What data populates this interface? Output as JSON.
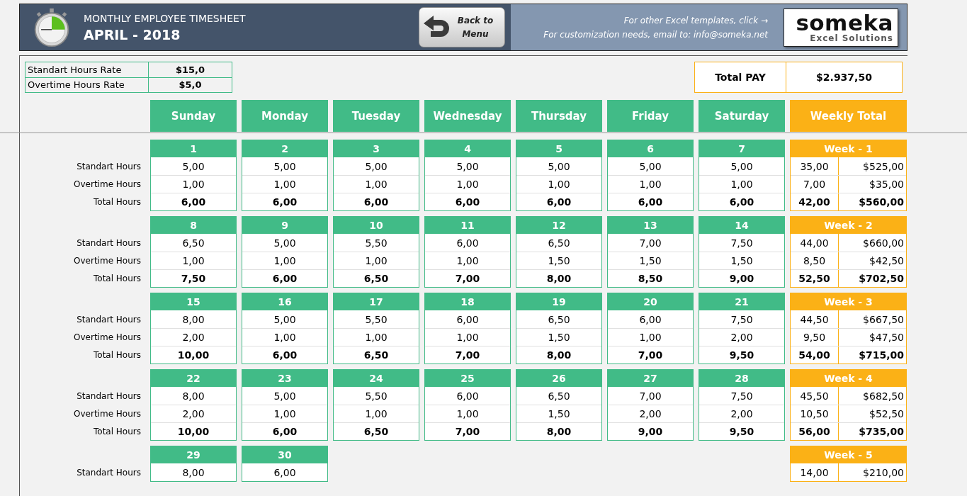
{
  "header": {
    "subtitle": "MONTHLY EMPLOYEE TIMESHEET",
    "title": "APRIL - 2018",
    "back_button": "Back to Menu",
    "info_lines": [
      "For other Excel templates, click →",
      "For customization needs, email to: info@someka.net"
    ],
    "logo": {
      "name": "someka",
      "tagline": "Excel Solutions"
    }
  },
  "rates": [
    {
      "label": "Standart Hours Rate",
      "value": "$15,0"
    },
    {
      "label": "Overtime Hours Rate",
      "value": "$5,0"
    }
  ],
  "total_pay": {
    "label": "Total PAY",
    "value": "$2.937,50"
  },
  "day_names": [
    "Sunday",
    "Monday",
    "Tuesday",
    "Wednesday",
    "Thursday",
    "Friday",
    "Saturday"
  ],
  "weekly_total_label": "Weekly Total",
  "weeks": [
    {
      "label": "Week - 1",
      "dates": [
        "1",
        "2",
        "3",
        "4",
        "5",
        "6",
        "7"
      ],
      "rows": [
        {
          "kind": "standard",
          "label": "Standart Hours",
          "values": [
            "5,00",
            "5,00",
            "5,00",
            "5,00",
            "5,00",
            "5,00",
            "5,00"
          ],
          "hours": "35,00",
          "pay": "$525,00"
        },
        {
          "kind": "overtime",
          "label": "Overtime Hours",
          "values": [
            "1,00",
            "1,00",
            "1,00",
            "1,00",
            "1,00",
            "1,00",
            "1,00"
          ],
          "hours": "7,00",
          "pay": "$35,00"
        },
        {
          "kind": "total",
          "label": "Total Hours",
          "values": [
            "6,00",
            "6,00",
            "6,00",
            "6,00",
            "6,00",
            "6,00",
            "6,00"
          ],
          "hours": "42,00",
          "pay": "$560,00"
        }
      ]
    },
    {
      "label": "Week - 2",
      "dates": [
        "8",
        "9",
        "10",
        "11",
        "12",
        "13",
        "14"
      ],
      "rows": [
        {
          "kind": "standard",
          "label": "Standart Hours",
          "values": [
            "6,50",
            "5,00",
            "5,50",
            "6,00",
            "6,50",
            "7,00",
            "7,50"
          ],
          "hours": "44,00",
          "pay": "$660,00"
        },
        {
          "kind": "overtime",
          "label": "Overtime Hours",
          "values": [
            "1,00",
            "1,00",
            "1,00",
            "1,00",
            "1,50",
            "1,50",
            "1,50"
          ],
          "hours": "8,50",
          "pay": "$42,50"
        },
        {
          "kind": "total",
          "label": "Total Hours",
          "values": [
            "7,50",
            "6,00",
            "6,50",
            "7,00",
            "8,00",
            "8,50",
            "9,00"
          ],
          "hours": "52,50",
          "pay": "$702,50"
        }
      ]
    },
    {
      "label": "Week - 3",
      "dates": [
        "15",
        "16",
        "17",
        "18",
        "19",
        "20",
        "21"
      ],
      "rows": [
        {
          "kind": "standard",
          "label": "Standart Hours",
          "values": [
            "8,00",
            "5,00",
            "5,50",
            "6,00",
            "6,50",
            "6,00",
            "7,50"
          ],
          "hours": "44,50",
          "pay": "$667,50"
        },
        {
          "kind": "overtime",
          "label": "Overtime Hours",
          "values": [
            "2,00",
            "1,00",
            "1,00",
            "1,00",
            "1,50",
            "1,00",
            "2,00"
          ],
          "hours": "9,50",
          "pay": "$47,50"
        },
        {
          "kind": "total",
          "label": "Total Hours",
          "values": [
            "10,00",
            "6,00",
            "6,50",
            "7,00",
            "8,00",
            "7,00",
            "9,50"
          ],
          "hours": "54,00",
          "pay": "$715,00"
        }
      ]
    },
    {
      "label": "Week - 4",
      "dates": [
        "22",
        "23",
        "24",
        "25",
        "26",
        "27",
        "28"
      ],
      "rows": [
        {
          "kind": "standard",
          "label": "Standart Hours",
          "values": [
            "8,00",
            "5,00",
            "5,50",
            "6,00",
            "6,50",
            "7,00",
            "7,50"
          ],
          "hours": "45,50",
          "pay": "$682,50"
        },
        {
          "kind": "overtime",
          "label": "Overtime Hours",
          "values": [
            "2,00",
            "1,00",
            "1,00",
            "1,00",
            "1,50",
            "2,00",
            "2,00"
          ],
          "hours": "10,50",
          "pay": "$52,50"
        },
        {
          "kind": "total",
          "label": "Total Hours",
          "values": [
            "10,00",
            "6,00",
            "6,50",
            "7,00",
            "8,00",
            "9,00",
            "9,50"
          ],
          "hours": "56,00",
          "pay": "$735,00"
        }
      ]
    },
    {
      "label": "Week - 5",
      "dates": [
        "29",
        "30"
      ],
      "rows": [
        {
          "kind": "standard",
          "label": "Standart Hours",
          "values": [
            "8,00",
            "6,00"
          ],
          "hours": "14,00",
          "pay": "$210,00"
        }
      ]
    }
  ]
}
